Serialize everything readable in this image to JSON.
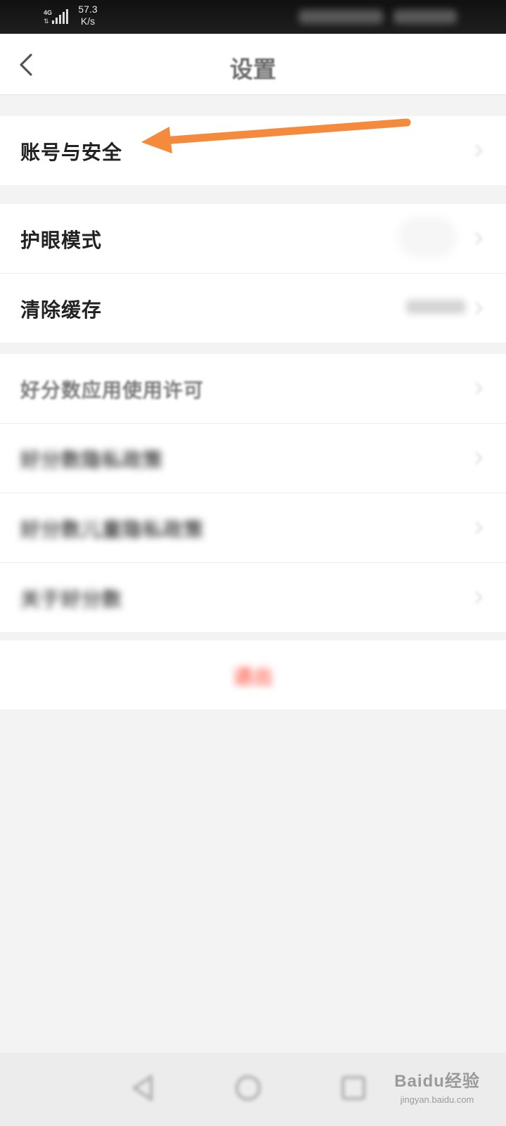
{
  "status_bar": {
    "network_type": "4G",
    "speed_value": "57.3",
    "speed_unit": "K/s"
  },
  "header": {
    "title": "设置",
    "back_icon": "chevron-left-icon"
  },
  "groups": [
    {
      "items": [
        {
          "label": "账号与安全"
        }
      ]
    },
    {
      "items": [
        {
          "label": "护眼模式"
        },
        {
          "label": "清除缓存"
        }
      ]
    },
    {
      "items": [
        {
          "label": "好分数应用使用许可"
        },
        {
          "label": "好分数隐私政策"
        },
        {
          "label": "好分数儿童隐私政策"
        },
        {
          "label": "关于好分数"
        }
      ]
    }
  ],
  "logout": {
    "label": "退出"
  },
  "annotation": {
    "type": "arrow",
    "color": "#f58a3c",
    "points_to": "账号与安全"
  },
  "watermark": {
    "title": "Baidu经验",
    "url": "jingyan.baidu.com"
  },
  "colors": {
    "background": "#f3f3f3",
    "logout_text": "#ff6a5a",
    "annotation_arrow": "#f58a3c"
  }
}
